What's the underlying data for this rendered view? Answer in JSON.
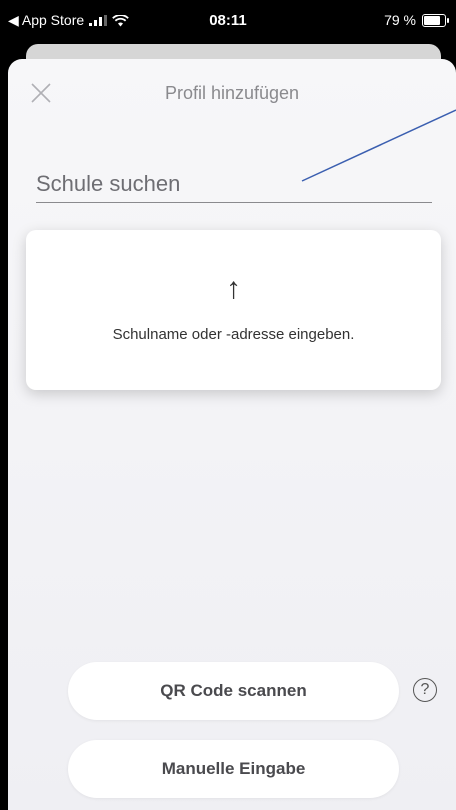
{
  "status_bar": {
    "back_label": "◀ App Store",
    "time": "08:11",
    "battery_percent": "79 %",
    "battery_level": 0.79
  },
  "sheet": {
    "title": "Profil hinzufügen",
    "close_icon": "close-icon"
  },
  "search": {
    "placeholder": "Schule suchen",
    "value": ""
  },
  "hint_card": {
    "icon": "arrow-up-icon",
    "text": "Schulname oder -adresse eingeben."
  },
  "buttons": {
    "qr_label": "QR Code scannen",
    "manual_label": "Manuelle Eingabe",
    "help_icon": "question-circle-icon",
    "help_glyph": "?"
  },
  "colors": {
    "annotation_line": "#3b5fb0",
    "title": "#8a8a8e"
  }
}
